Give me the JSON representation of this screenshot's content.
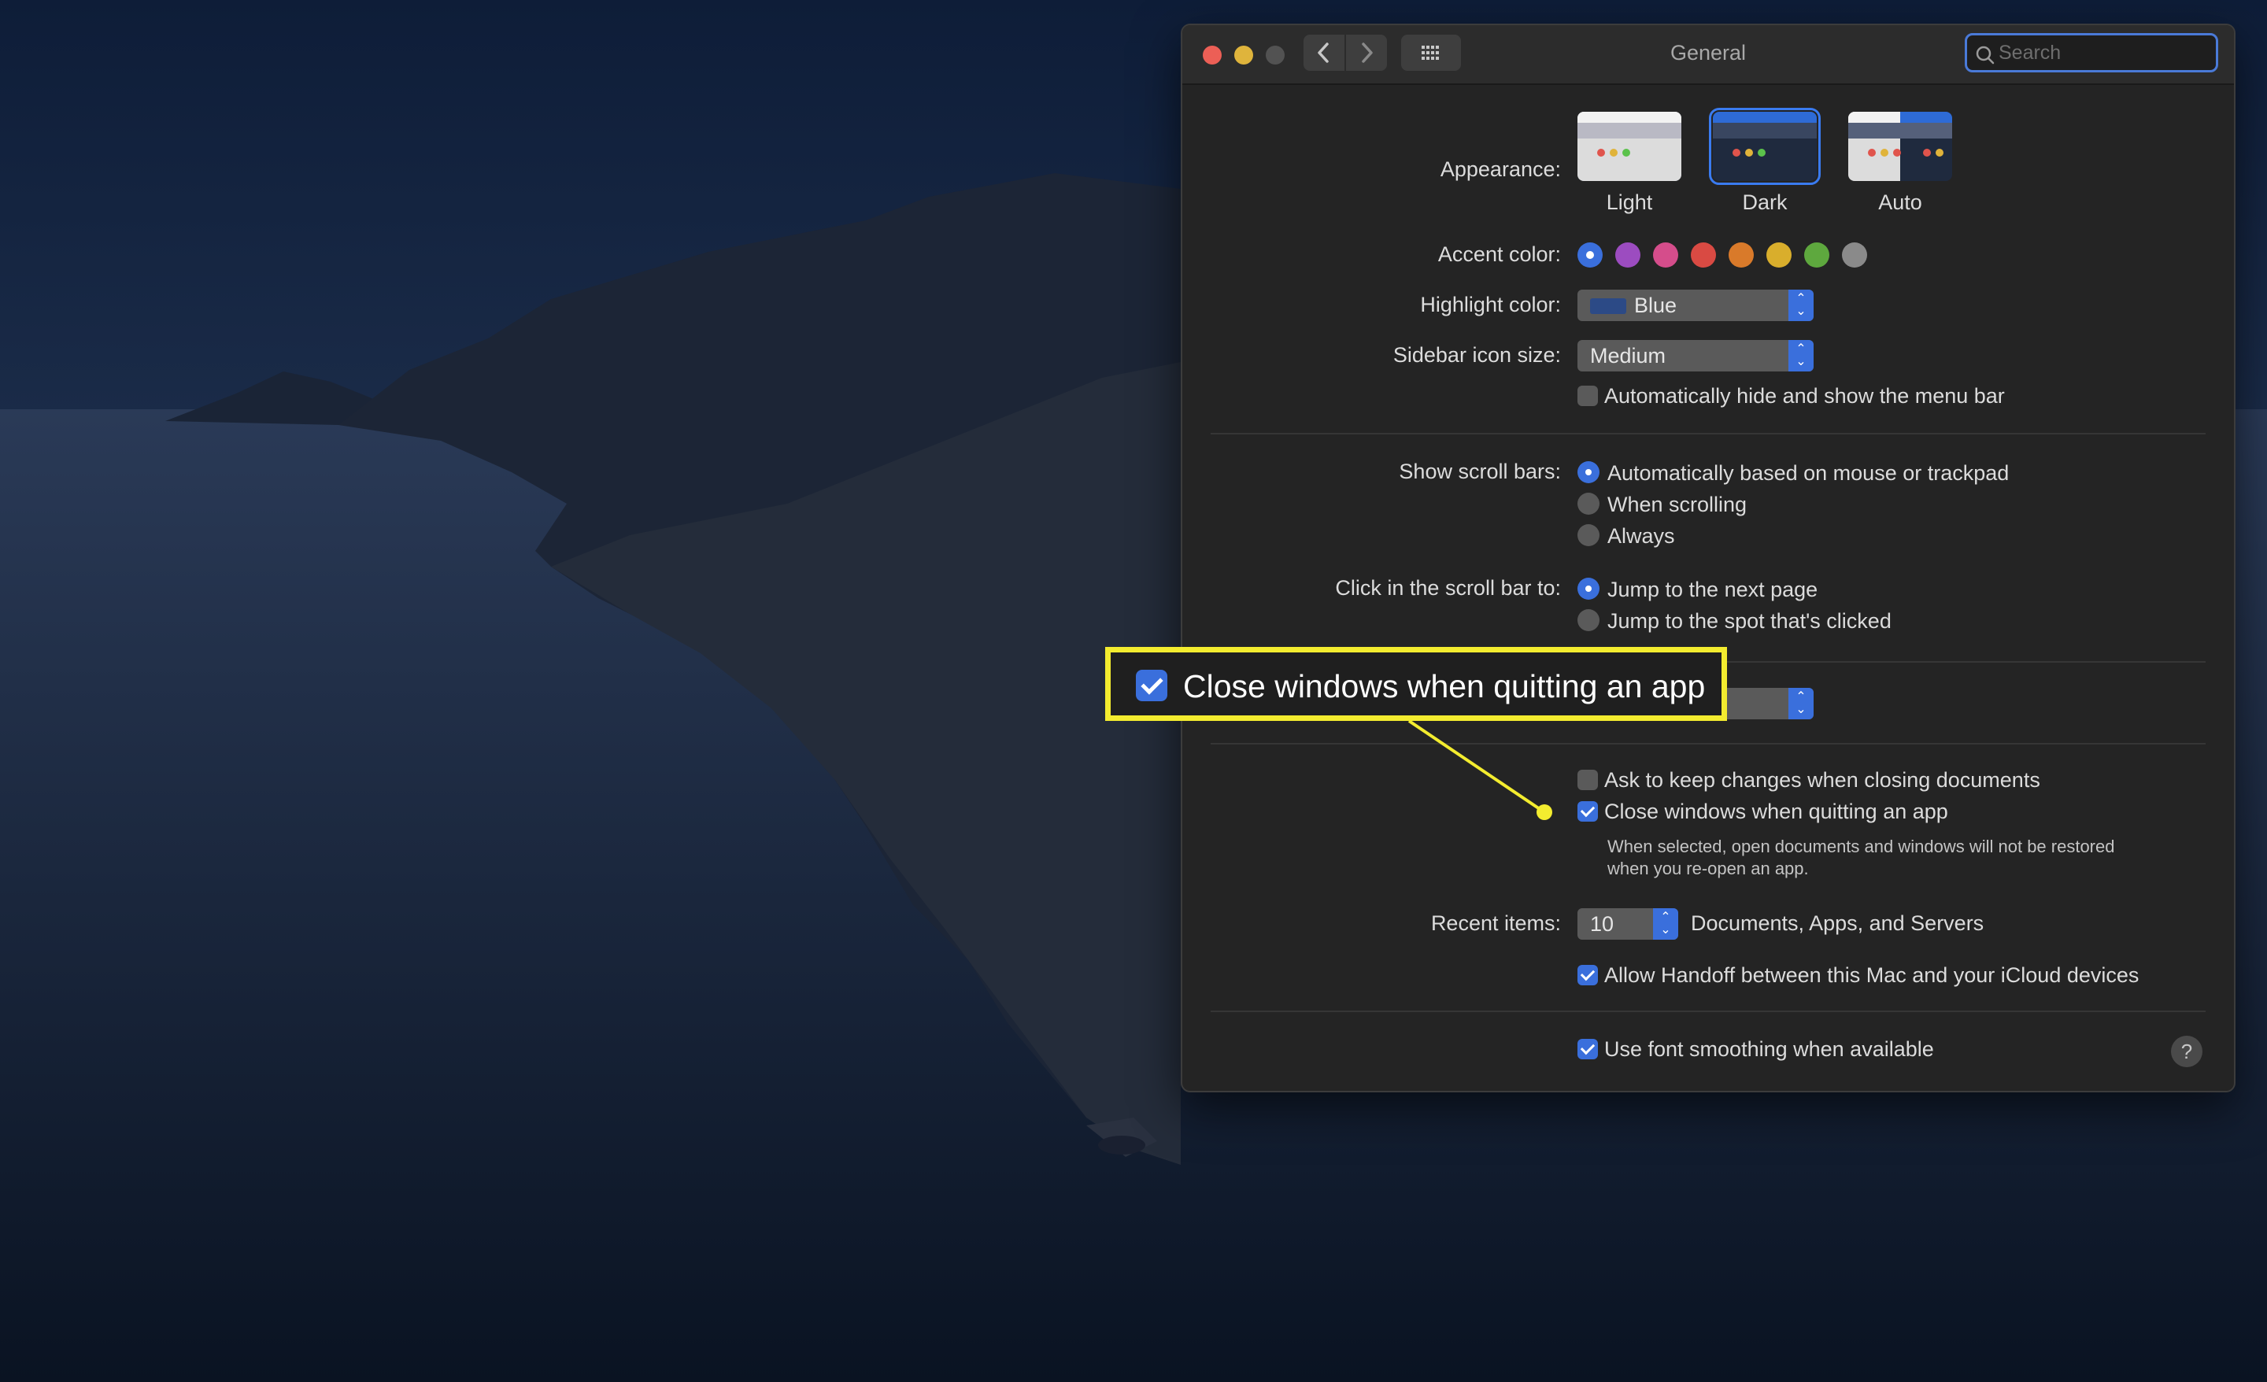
{
  "window": {
    "title": "General",
    "search_placeholder": "Search"
  },
  "appearance": {
    "label": "Appearance:",
    "options": [
      "Light",
      "Dark",
      "Auto"
    ],
    "selected": "Dark"
  },
  "accent": {
    "label": "Accent color:",
    "colors": [
      "#3a6fdc",
      "#9c4cc0",
      "#d54d8b",
      "#d94a43",
      "#d97a2a",
      "#d9ae2c",
      "#5ea83e",
      "#8a8a8a"
    ],
    "selected_index": 0
  },
  "highlight": {
    "label": "Highlight color:",
    "value": "Blue",
    "swatch_color": "#2c4a86"
  },
  "sidebar": {
    "label": "Sidebar icon size:",
    "value": "Medium"
  },
  "menubar": {
    "auto_hide_label": "Automatically hide and show the menu bar",
    "auto_hide_checked": false
  },
  "scrollbars": {
    "label": "Show scroll bars:",
    "options": [
      "Automatically based on mouse or trackpad",
      "When scrolling",
      "Always"
    ],
    "selected_index": 0
  },
  "click_scroll": {
    "label": "Click in the scroll bar to:",
    "options": [
      "Jump to the next page",
      "Jump to the spot that's clicked"
    ],
    "selected_index": 0
  },
  "documents": {
    "ask_keep_label": "Ask to keep changes when closing documents",
    "ask_keep_checked": false,
    "close_windows_label": "Close windows when quitting an app",
    "close_windows_checked": true,
    "close_windows_note_line1": "When selected, open documents and windows will not be restored",
    "close_windows_note_line2": "when you re-open an app."
  },
  "recent": {
    "label": "Recent items:",
    "value": "10",
    "suffix": "Documents, Apps, and Servers"
  },
  "handoff": {
    "label": "Allow Handoff between this Mac and your iCloud devices",
    "checked": true
  },
  "font_smoothing": {
    "label": "Use font smoothing when available",
    "checked": true
  },
  "help": {
    "glyph": "?"
  },
  "callout": {
    "text": "Close windows when quitting an app",
    "checked": true,
    "color": "#f3ec2f"
  }
}
